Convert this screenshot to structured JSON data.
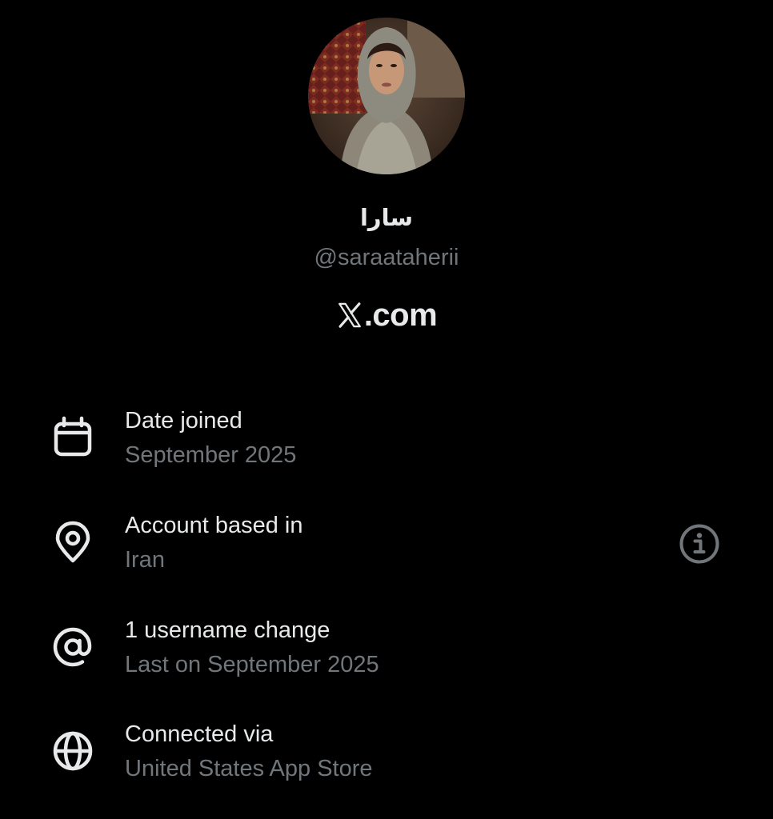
{
  "profile": {
    "display_name": "سارا",
    "handle": "@saraataherii",
    "avatar": "profile-photo"
  },
  "brand": {
    "logo": "x-logo-icon",
    "text": ".com"
  },
  "details": [
    {
      "icon": "calendar-icon",
      "title": "Date joined",
      "value": "September 2025"
    },
    {
      "icon": "location-pin-icon",
      "title": "Account based in",
      "value": "Iran"
    },
    {
      "icon": "at-sign-icon",
      "title": "1 username change",
      "value": "Last on September 2025"
    },
    {
      "icon": "globe-icon",
      "title": "Connected via",
      "value": "United States App Store"
    }
  ],
  "info_button": {
    "icon": "info-icon"
  },
  "colors": {
    "background": "#000000",
    "primary_text": "#e7e9ea",
    "secondary_text": "#71767b"
  }
}
